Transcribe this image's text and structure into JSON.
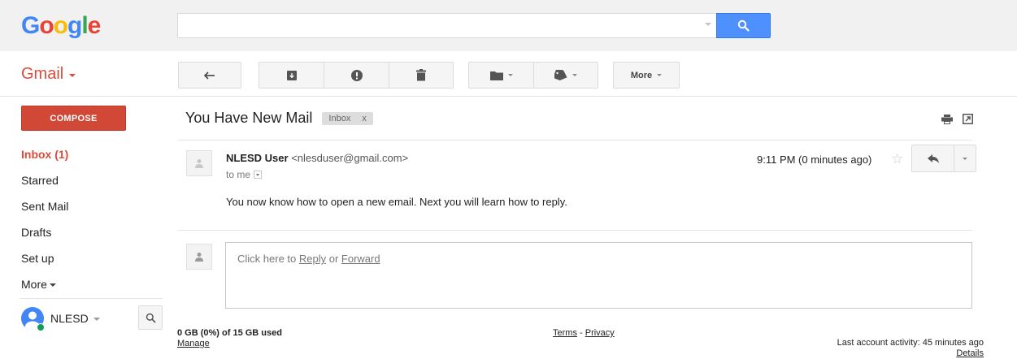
{
  "brand": {
    "logo_letters": [
      "G",
      "o",
      "o",
      "g",
      "l",
      "e"
    ],
    "logo_colors": [
      "#4285f4",
      "#ea4335",
      "#fbbc05",
      "#4285f4",
      "#34a853",
      "#ea4335"
    ],
    "app_label": "Gmail"
  },
  "search": {
    "value": "",
    "placeholder": ""
  },
  "toolbar": {
    "more_label": "More"
  },
  "compose": {
    "label": "COMPOSE"
  },
  "nav": {
    "items": [
      {
        "label": "Inbox (1)",
        "active": true
      },
      {
        "label": "Starred"
      },
      {
        "label": "Sent Mail"
      },
      {
        "label": "Drafts"
      },
      {
        "label": "Set up"
      },
      {
        "label": "More"
      }
    ]
  },
  "hangouts": {
    "name": "NLESD"
  },
  "thread": {
    "subject": "You Have New Mail",
    "label": "Inbox",
    "label_remove": "x"
  },
  "message": {
    "sender_name": "NLESD User",
    "sender_email": "<nlesduser@gmail.com>",
    "to": "to me",
    "time": "9:11 PM (0 minutes ago)",
    "body": "You now know how to open a new email.  Next you will learn how to reply."
  },
  "reply": {
    "prefix": "Click here to ",
    "reply_link": "Reply",
    "or": " or ",
    "forward_link": "Forward"
  },
  "footer": {
    "storage": "0 GB (0%) of 15 GB used",
    "manage": "Manage",
    "terms": "Terms",
    "sep": " - ",
    "privacy": "Privacy",
    "activity": "Last account activity: 45 minutes ago",
    "details": "Details"
  },
  "colors": {
    "accent_red": "#dd4b39",
    "search_blue": "#4d90fe",
    "compose_red": "#d14836"
  }
}
